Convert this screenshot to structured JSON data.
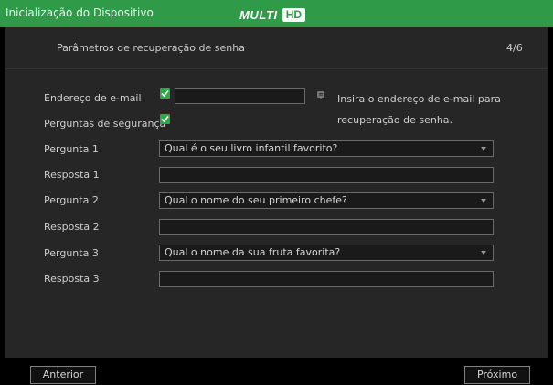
{
  "window": {
    "title": "Inicialização do Dispositivo"
  },
  "logo": {
    "word": "MULTI",
    "badge": "HD"
  },
  "header": {
    "section_title": "Parâmetros de recuperação de senha",
    "step": "4/6"
  },
  "email": {
    "label": "Endereço de e-mail",
    "enabled": true,
    "value": "",
    "hint": "Insira o endereço de e-mail para recuperação de senha."
  },
  "security": {
    "label": "Perguntas de segurança",
    "enabled": true
  },
  "questions": [
    {
      "question_label": "Pergunta 1",
      "question_value": "Qual é o seu livro infantil favorito?",
      "answer_label": "Resposta 1",
      "answer_value": ""
    },
    {
      "question_label": "Pergunta 2",
      "question_value": "Qual o nome do seu primeiro chefe?",
      "answer_label": "Resposta 2",
      "answer_value": ""
    },
    {
      "question_label": "Pergunta 3",
      "question_value": "Qual o nome da sua fruta favorita?",
      "answer_label": "Resposta 3",
      "answer_value": ""
    }
  ],
  "footer": {
    "back_label": "Anterior",
    "next_label": "Próximo"
  },
  "colors": {
    "accent": "#2f9a48",
    "checkbox": "#2fa84a",
    "panel": "#262626"
  },
  "icons": {
    "checkbox": "check-icon",
    "info": "info-icon",
    "dropdown": "chevron-down-icon"
  }
}
